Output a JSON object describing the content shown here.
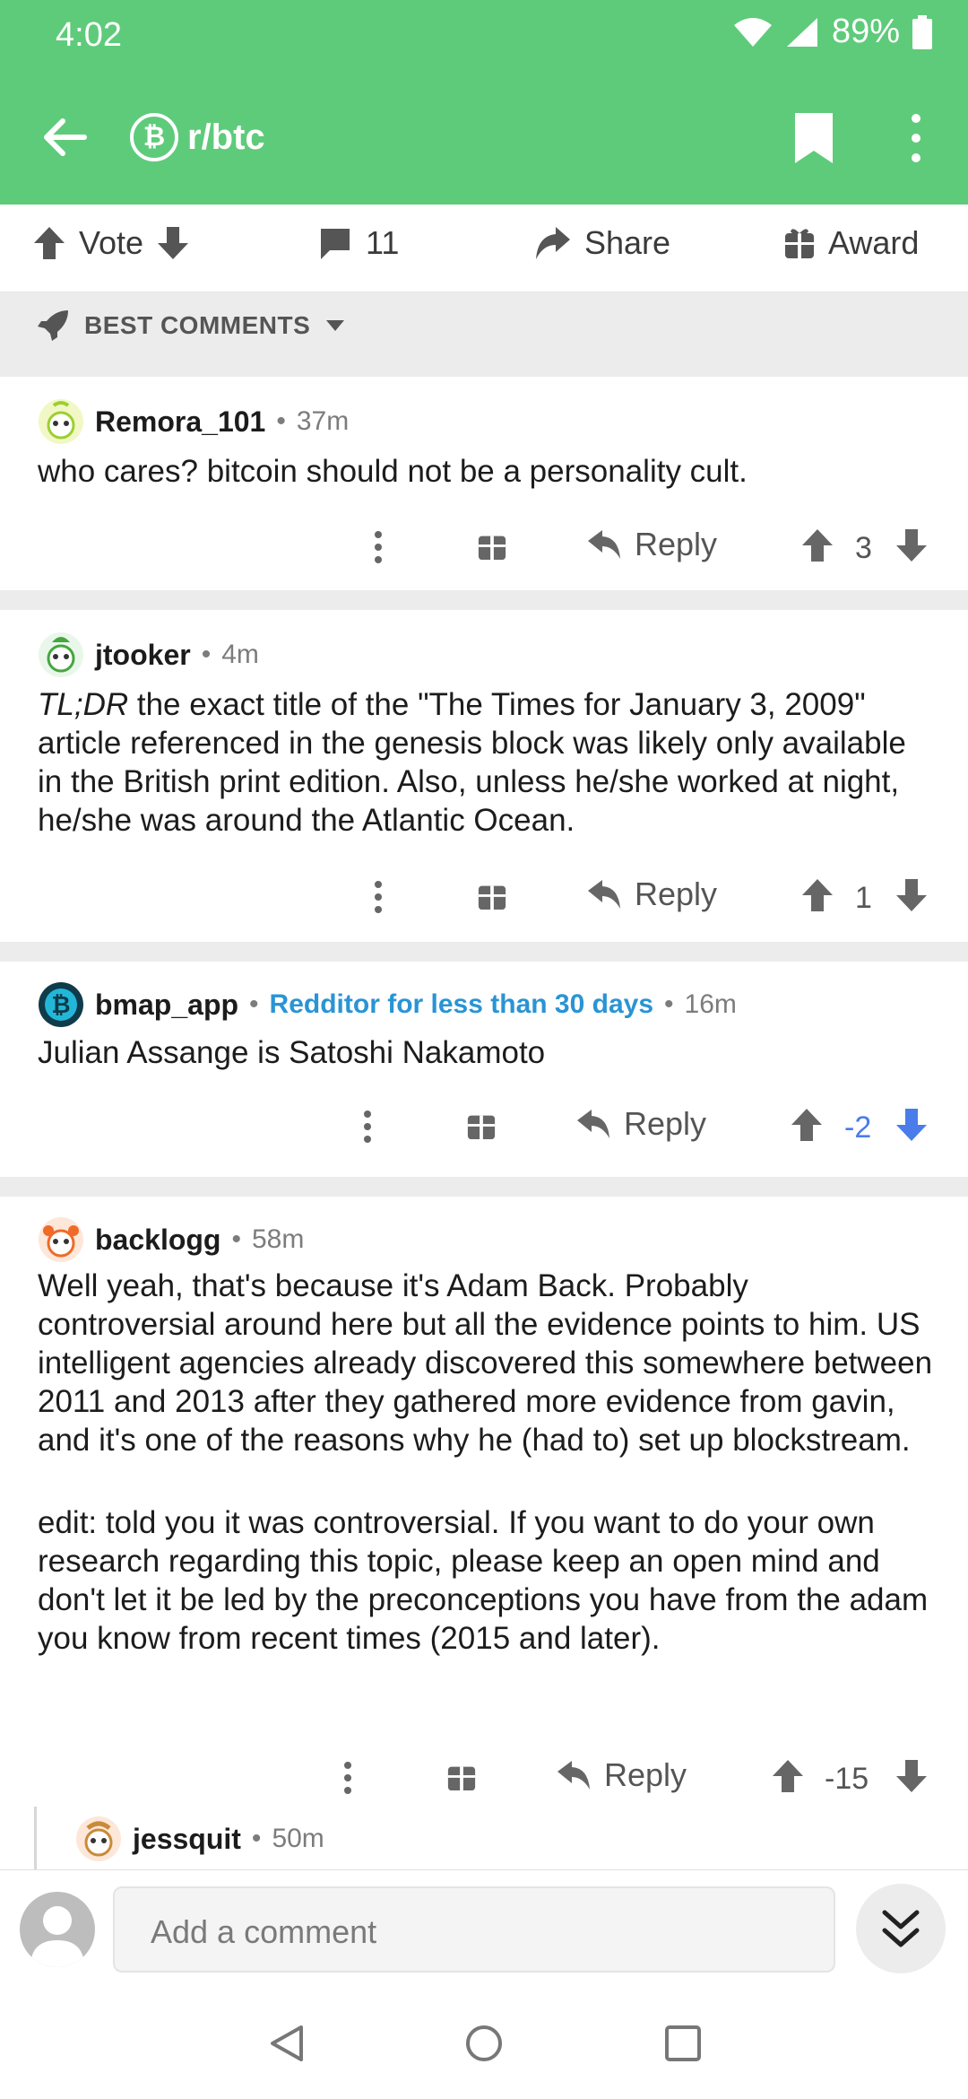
{
  "status_bar": {
    "time": "4:02",
    "battery": "89%"
  },
  "app_bar": {
    "subreddit": "r/btc"
  },
  "post_actions": {
    "vote": "Vote",
    "comments_count": "11",
    "share": "Share",
    "award": "Award"
  },
  "sort": {
    "label": "BEST COMMENTS"
  },
  "comments": [
    {
      "author": "Remora_101",
      "time": "37m",
      "body": [
        "who cares? bitcoin should not be a personality cult."
      ],
      "reply_label": "Reply",
      "score": "3"
    },
    {
      "author": "jtooker",
      "time": "4m",
      "body_italic": "TL;DR",
      "body_rest": " the exact title of the \"The Times for January 3, 2009\" article referenced in the genesis block was likely only available in the British print edition.  Also, unless he/she worked at night, he/she was around the Atlantic Ocean.",
      "reply_label": "Reply",
      "score": "1"
    },
    {
      "author": "bmap_app",
      "flair": "Redditor for less than 30 days",
      "time": "16m",
      "body": [
        "Julian Assange is Satoshi Nakamoto"
      ],
      "reply_label": "Reply",
      "score": "-2"
    },
    {
      "author": "backlogg",
      "time": "58m",
      "body": [
        "Well yeah, that's because it's Adam Back. Probably controversial around here but all the evidence points to him. US intelligent agencies already discovered this somewhere between 2011 and 2013 after they gathered more evidence from gavin, and it's one of the reasons why he (had to) set up blockstream.",
        "edit: told you it was controversial. If you want to do your own research regarding this topic, please keep an open mind and don't let it be led by the preconceptions you have from the adam you know from recent times (2015 and later)."
      ],
      "reply_label": "Reply",
      "score": "-15"
    },
    {
      "author": "jessquit",
      "time": "50m"
    }
  ],
  "composer": {
    "placeholder": "Add a comment"
  },
  "colors": {
    "accent": "#5ecb7a",
    "downvote_active": "#4a7de9",
    "flair": "#2a94d4"
  }
}
